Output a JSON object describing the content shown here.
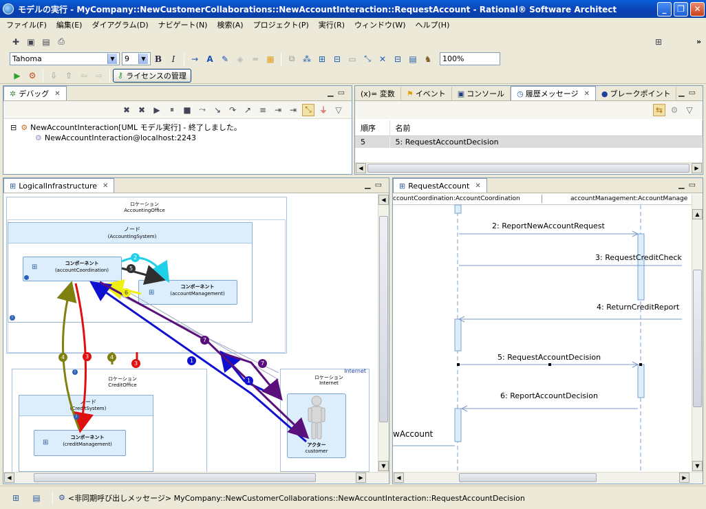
{
  "window": {
    "title": "モデルの実行 - MyCompany::NewCustomerCollaborations::NewAccountInteraction::RequestAccount - Rational® Software Architect",
    "min": "_",
    "max": "❐",
    "close": "✕"
  },
  "menu": [
    "ファイル(F)",
    "編集(E)",
    "ダイアグラム(D)",
    "ナビゲート(N)",
    "検索(A)",
    "プロジェクト(P)",
    "実行(R)",
    "ウィンドウ(W)",
    "ヘルプ(H)"
  ],
  "toolbar": {
    "font_name": "Tahoma",
    "font_size": "9",
    "bold": "B",
    "italic": "I",
    "zoom": "100%",
    "license_button": "ライセンスの管理",
    "overflow": "»"
  },
  "debug_view": {
    "tab_label": "デバッグ",
    "tree": [
      {
        "label": "NewAccountInteraction[UML モデル実行] - 終了しました。",
        "expander": "⊟"
      },
      {
        "label": "NewAccountInteraction@localhost:2243"
      }
    ]
  },
  "right_top_view": {
    "tabs": [
      {
        "label": "(x)= 変数"
      },
      {
        "label": "イベント"
      },
      {
        "label": "コンソール"
      },
      {
        "label": "履歴メッセージ"
      },
      {
        "label": "ブレークポイント"
      }
    ],
    "columns": [
      "順序",
      "名前"
    ],
    "rows": [
      {
        "order": "5",
        "name": "5: RequestAccountDecision"
      }
    ]
  },
  "diagram_view": {
    "tab_label": "LogicalInfrastructure",
    "accounting_office": {
      "stereo": "ロケーション",
      "name": "AccountingOffice"
    },
    "accounting_system": {
      "stereo": "ノード",
      "name": "(AccountingSystem)"
    },
    "account_coordination": {
      "stereo": "コンポーネント",
      "name": "(accountCoordination)"
    },
    "account_management": {
      "stereo": "コンポーネント",
      "name": "(accountManagement)"
    },
    "credit_office": {
      "stereo": "ロケーション",
      "name": "CreditOffice"
    },
    "credit_system": {
      "stereo": "ノード",
      "name": "(CreditSystem)"
    },
    "credit_management": {
      "stereo": "コンポーネント",
      "name": "(creditManagement)"
    },
    "internet": {
      "stereo": "ロケーション",
      "name": "Internet",
      "title": "Internet"
    },
    "customer": {
      "stereo": "アクター",
      "name": "customer"
    },
    "markers": [
      "1",
      "1",
      "2",
      "3",
      "3",
      "4",
      "4",
      "5",
      "6",
      "7",
      "7",
      "i",
      "i",
      "i"
    ]
  },
  "sequence_view": {
    "tab_label": "RequestAccount",
    "lifelines": [
      "ccountCoordination:AccountCoordination",
      "accountManagement:AccountManage"
    ],
    "messages": [
      "2: ReportNewAccountRequest",
      "3: RequestCreditCheck",
      "4: ReturnCreditReport",
      "5: RequestAccountDecision",
      "6: ReportAccountDecision",
      "wAccount"
    ]
  },
  "statusbar": {
    "message": "<非同期呼び出しメッセージ> MyCompany::NewCustomerCollaborations::NewAccountInteraction::RequestAccountDecision"
  },
  "colors": {
    "title_bar": "#0a4fc8",
    "arrow_blue": "#1010d0",
    "arrow_red": "#e01010",
    "arrow_olive": "#808010",
    "arrow_purple": "#5a107a",
    "arrow_cyan": "#20d0e8",
    "arrow_dark": "#303030",
    "arrow_yellow": "#f0f010",
    "node_fill": "#dceefc"
  }
}
